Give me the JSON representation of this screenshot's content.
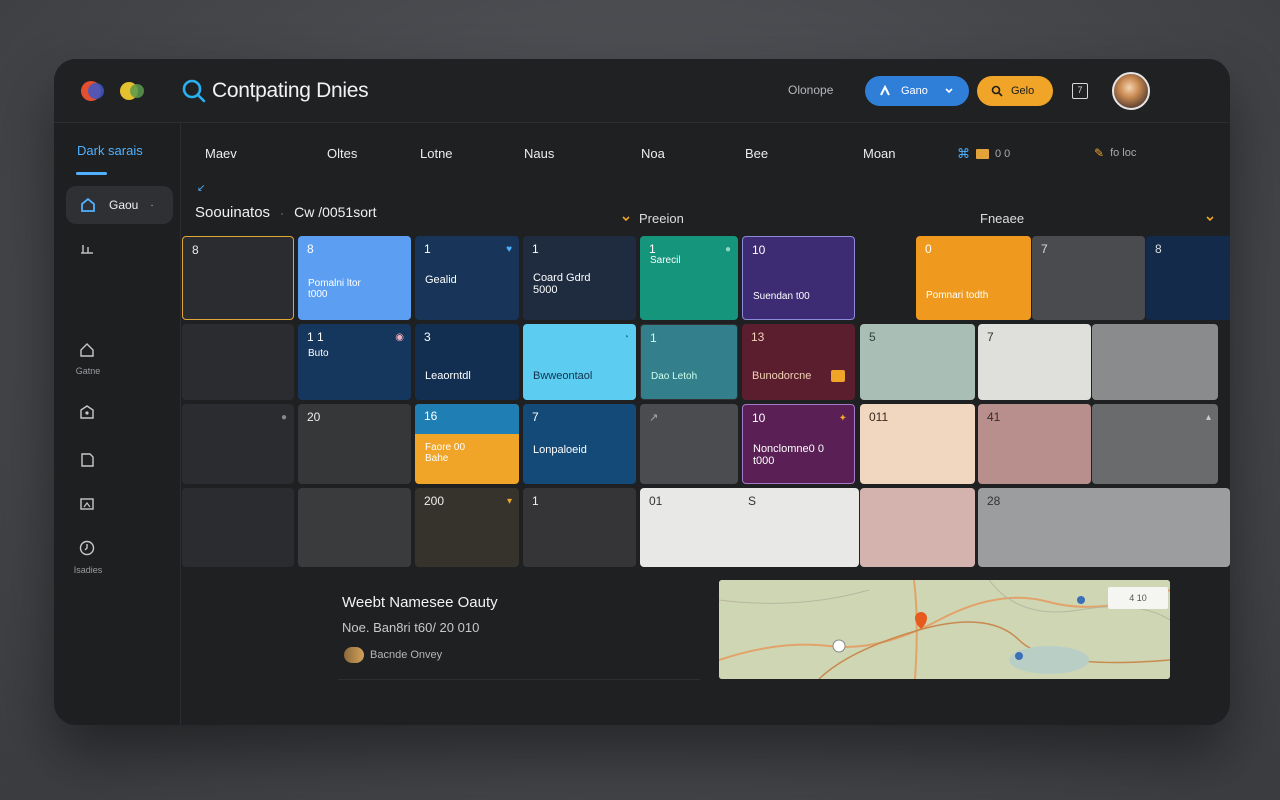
{
  "header": {
    "title": "Contpating Dnies",
    "link": "Olonope",
    "primary_button": "Gano",
    "secondary_button": "Gelo",
    "square_label": "7"
  },
  "sidebar": {
    "title": "Dark  sarais",
    "active_item": "Gaou",
    "items": [
      {
        "label": ""
      },
      {
        "label": "Gatne"
      },
      {
        "label": ""
      },
      {
        "label": ""
      },
      {
        "label": ""
      },
      {
        "label": "Isadies"
      }
    ]
  },
  "columns": [
    "Maev",
    "Oltes",
    "Lotne",
    "Naus",
    "Noa",
    "Bee",
    "Moan",
    "0 0",
    "fo loc"
  ],
  "toolbar": {
    "title": "Soouinatos",
    "subtitle": "Cw /0051sort",
    "select_1": "Preeion",
    "select_2": "Fneaee"
  },
  "calendar": {
    "rows": [
      [
        {
          "num": "8",
          "text": ""
        },
        {
          "num": "8",
          "text": "Pomalni ltor\nt000"
        },
        {
          "num": "1",
          "text": "Gealid"
        },
        {
          "num": "1",
          "text": "Coard Gdrd\n5000"
        },
        {
          "num": "1",
          "text": "Sarecil"
        },
        {
          "num": "10",
          "text": "Suendan t00"
        },
        {
          "num": "0",
          "text": "Pomnari todth"
        },
        {
          "num": "7",
          "text": ""
        },
        {
          "num": "8",
          "text": ""
        }
      ],
      [
        {
          "num": "1 1",
          "text": "Buto"
        },
        {
          "num": "3",
          "text": "Leaorntdl"
        },
        {
          "num": "",
          "text": "Bwweontaol"
        },
        {
          "num": "1",
          "text": "Dao Letoh"
        },
        {
          "num": "13",
          "text": "Bunodorcne"
        },
        {
          "num": "5",
          "text": ""
        },
        {
          "num": "7",
          "text": ""
        }
      ],
      [
        {
          "num": "20",
          "text": ""
        },
        {
          "num": "16",
          "text": "Faore 00\nBahe"
        },
        {
          "num": "7",
          "text": "Lonpaloeid"
        },
        {
          "num": "",
          "text": ""
        },
        {
          "num": "10",
          "text": "Nonclomne0 0\nt000"
        },
        {
          "num": "011",
          "text": ""
        },
        {
          "num": "41",
          "text": ""
        }
      ],
      [
        {
          "num": "200",
          "text": ""
        },
        {
          "num": "1",
          "text": ""
        },
        {
          "num": "01",
          "text": ""
        },
        {
          "num": "S",
          "text": ""
        },
        {
          "num": "28",
          "text": ""
        }
      ]
    ]
  },
  "event_panel": {
    "title": "Weebt Namesee Oauty",
    "subtitle": "Noe. Ban8ri t60/ 20 010",
    "meta": "Bacnde Onvey"
  },
  "map": {
    "label": "4 10"
  },
  "colors": {
    "accent_blue": "#2f7fd9",
    "accent_orange": "#f0a428",
    "link_blue": "#4fb1ff"
  }
}
